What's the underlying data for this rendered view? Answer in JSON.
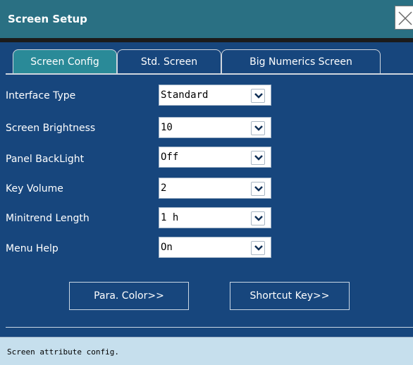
{
  "window": {
    "title": "Screen Setup"
  },
  "tabs": [
    {
      "label": "Screen Config",
      "active": true
    },
    {
      "label": "Std. Screen",
      "active": false
    },
    {
      "label": "Big Numerics Screen",
      "active": false
    }
  ],
  "settings": [
    {
      "label": "Interface Type",
      "value": "Standard"
    },
    {
      "label": "Screen Brightness",
      "value": "10"
    },
    {
      "label": "Panel BackLight",
      "value": "Off"
    },
    {
      "label": "Key Volume",
      "value": "2"
    },
    {
      "label": "Minitrend Length",
      "value": "1 h"
    },
    {
      "label": "Menu Help",
      "value": "On"
    }
  ],
  "buttons": {
    "para_color": "Para. Color>>",
    "shortcut_key": "Shortcut Key>>"
  },
  "status": {
    "text": "Screen attribute config."
  },
  "colors": {
    "panel": "#17467d",
    "titlebar": "#2a7083",
    "active_tab": "#2a8a98",
    "statusbar": "#c6dfed"
  },
  "icons": {
    "close": "close-icon",
    "dropdown": "chevron-down-icon"
  }
}
